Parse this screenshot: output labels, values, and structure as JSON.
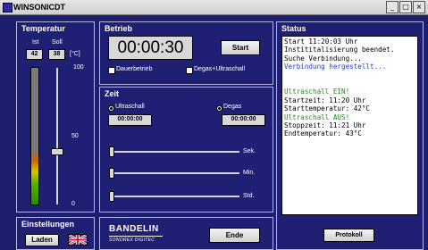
{
  "window": {
    "title": "WINSONICDT",
    "minimize": "_",
    "maximize": "□",
    "close": "×"
  },
  "temperature": {
    "title": "Temperatur",
    "ist_label": "Ist",
    "soll_label": "Soll",
    "unit_label": "[°C]",
    "ist_value": "42",
    "soll_value": "38",
    "scale_max": "100",
    "scale_mid": "50",
    "scale_min": "0",
    "setpoint_fraction": 0.38,
    "current_fraction": 0.42
  },
  "betrieb": {
    "title": "Betrieb",
    "timer": "00:00:30",
    "start_label": "Start",
    "dauerbetrieb_label": "Dauerbetrieb",
    "degas_ultraschall_label": "Degas+Ultraschall"
  },
  "zeit": {
    "title": "Zeit",
    "ultraschall_label": "Ultraschall",
    "ultraschall_time": "00:00:00",
    "degas_label": "Degas",
    "degas_time": "00:00:00",
    "sek_label": "Sek.",
    "min_label": "Min.",
    "std_label": "Std."
  },
  "status": {
    "title": "Status",
    "lines": [
      {
        "text": "Start 11:20:03 Uhr",
        "color": "#000000"
      },
      {
        "text": "Instititalisierung beendet.",
        "color": "#000000"
      },
      {
        "text": "Suche Verbindung...",
        "color": "#000000"
      },
      {
        "text": "Verbindung hergestellt...",
        "color": "#1a3fd0"
      },
      {
        "text": "",
        "color": "#000000"
      },
      {
        "text": "",
        "color": "#000000"
      },
      {
        "text": "Ultraschall EIN!",
        "color": "#1c8a1c"
      },
      {
        "text": "Startzeit: 11:20 Uhr",
        "color": "#000000"
      },
      {
        "text": "Starttemperatur: 42°C",
        "color": "#000000"
      },
      {
        "text": "Ultraschall AUS!",
        "color": "#1c8a1c"
      },
      {
        "text": "Stoppzeit: 11:21 Uhr",
        "color": "#000000"
      },
      {
        "text": "Endtemperatur: 43°C",
        "color": "#000000"
      }
    ],
    "protokoll_label": "Protokoll"
  },
  "einstellungen": {
    "title": "Einstellungen",
    "laden_label": "Laden"
  },
  "brand": {
    "name": "BANDELIN",
    "sub": "SONOREX DIGITEC"
  },
  "ende_label": "Ende",
  "colors": {
    "panel": "#1f1f74",
    "background": "#1e1e6e",
    "accent_blue": "#1a3fd0",
    "accent_green": "#1c8a1c"
  }
}
